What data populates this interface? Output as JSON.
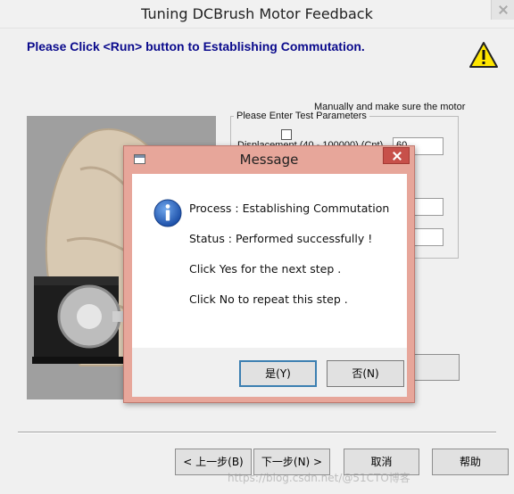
{
  "window": {
    "title": "Tuning DCBrush Motor Feedback",
    "instruction": "Please Click <Run> button to Establishing Commutation."
  },
  "icons": {
    "warning": "warning-icon",
    "info": "info-icon",
    "close": "close-icon"
  },
  "params": {
    "group_label": "Please Enter Test Parameters",
    "displacement_label": "Displacement  (40 - 100000)  (Cnt)",
    "displacement_value": "60",
    "behind_text": "Manually and make sure the motor"
  },
  "dialog": {
    "title": "Message",
    "lines": [
      "Process : Establishing Commutation",
      "Status  :  Performed successfully !",
      "Click Yes for the next step .",
      "Click No to repeat this step  ."
    ],
    "yes_label": "是(Y)",
    "no_label": "否(N)"
  },
  "nav": {
    "back_label": "< 上一步(B)",
    "next_label": "下一步(N) >",
    "cancel_label": "取消",
    "help_label": "帮助"
  },
  "watermark": "https://blog.csdn.net/@51CTO博客",
  "colors": {
    "instruction": "#0a0a8c",
    "dialog_frame": "#e7a69a",
    "dialog_close": "#c7504a",
    "info_blue": "#1c5fb8",
    "warning_yellow": "#ffe600"
  }
}
